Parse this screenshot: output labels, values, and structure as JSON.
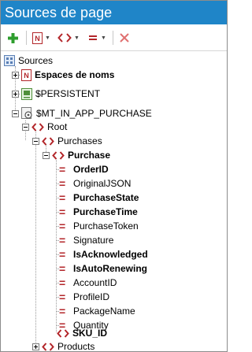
{
  "window": {
    "title": "Sources de page"
  },
  "toolbar": {
    "add": "add-icon",
    "namespace": "namespace-icon",
    "element": "element-icon",
    "attribute": "attribute-icon",
    "delete": "delete-icon"
  },
  "tree": {
    "root_label": "Sources",
    "namespaces": "Espaces de noms",
    "persistent": "$PERSISTENT",
    "inapp": "$MT_IN_APP_PURCHASE",
    "root": "Root",
    "purchases": "Purchases",
    "purchase": "Purchase",
    "attributes": [
      {
        "label": "OrderID",
        "bold": true
      },
      {
        "label": "OriginalJSON",
        "bold": false
      },
      {
        "label": "PurchaseState",
        "bold": true
      },
      {
        "label": "PurchaseTime",
        "bold": true
      },
      {
        "label": "PurchaseToken",
        "bold": false
      },
      {
        "label": "Signature",
        "bold": false
      },
      {
        "label": "IsAcknowledged",
        "bold": true
      },
      {
        "label": "IsAutoRenewing",
        "bold": true
      },
      {
        "label": "AccountID",
        "bold": false
      },
      {
        "label": "ProfileID",
        "bold": false
      },
      {
        "label": "PackageName",
        "bold": false
      },
      {
        "label": "Quantity",
        "bold": false
      }
    ],
    "sku": "SKU_ID",
    "products": "Products"
  },
  "colors": {
    "titlebar": "#1f85c8",
    "accent_red": "#b3262a",
    "add_green": "#2e9e2e"
  }
}
